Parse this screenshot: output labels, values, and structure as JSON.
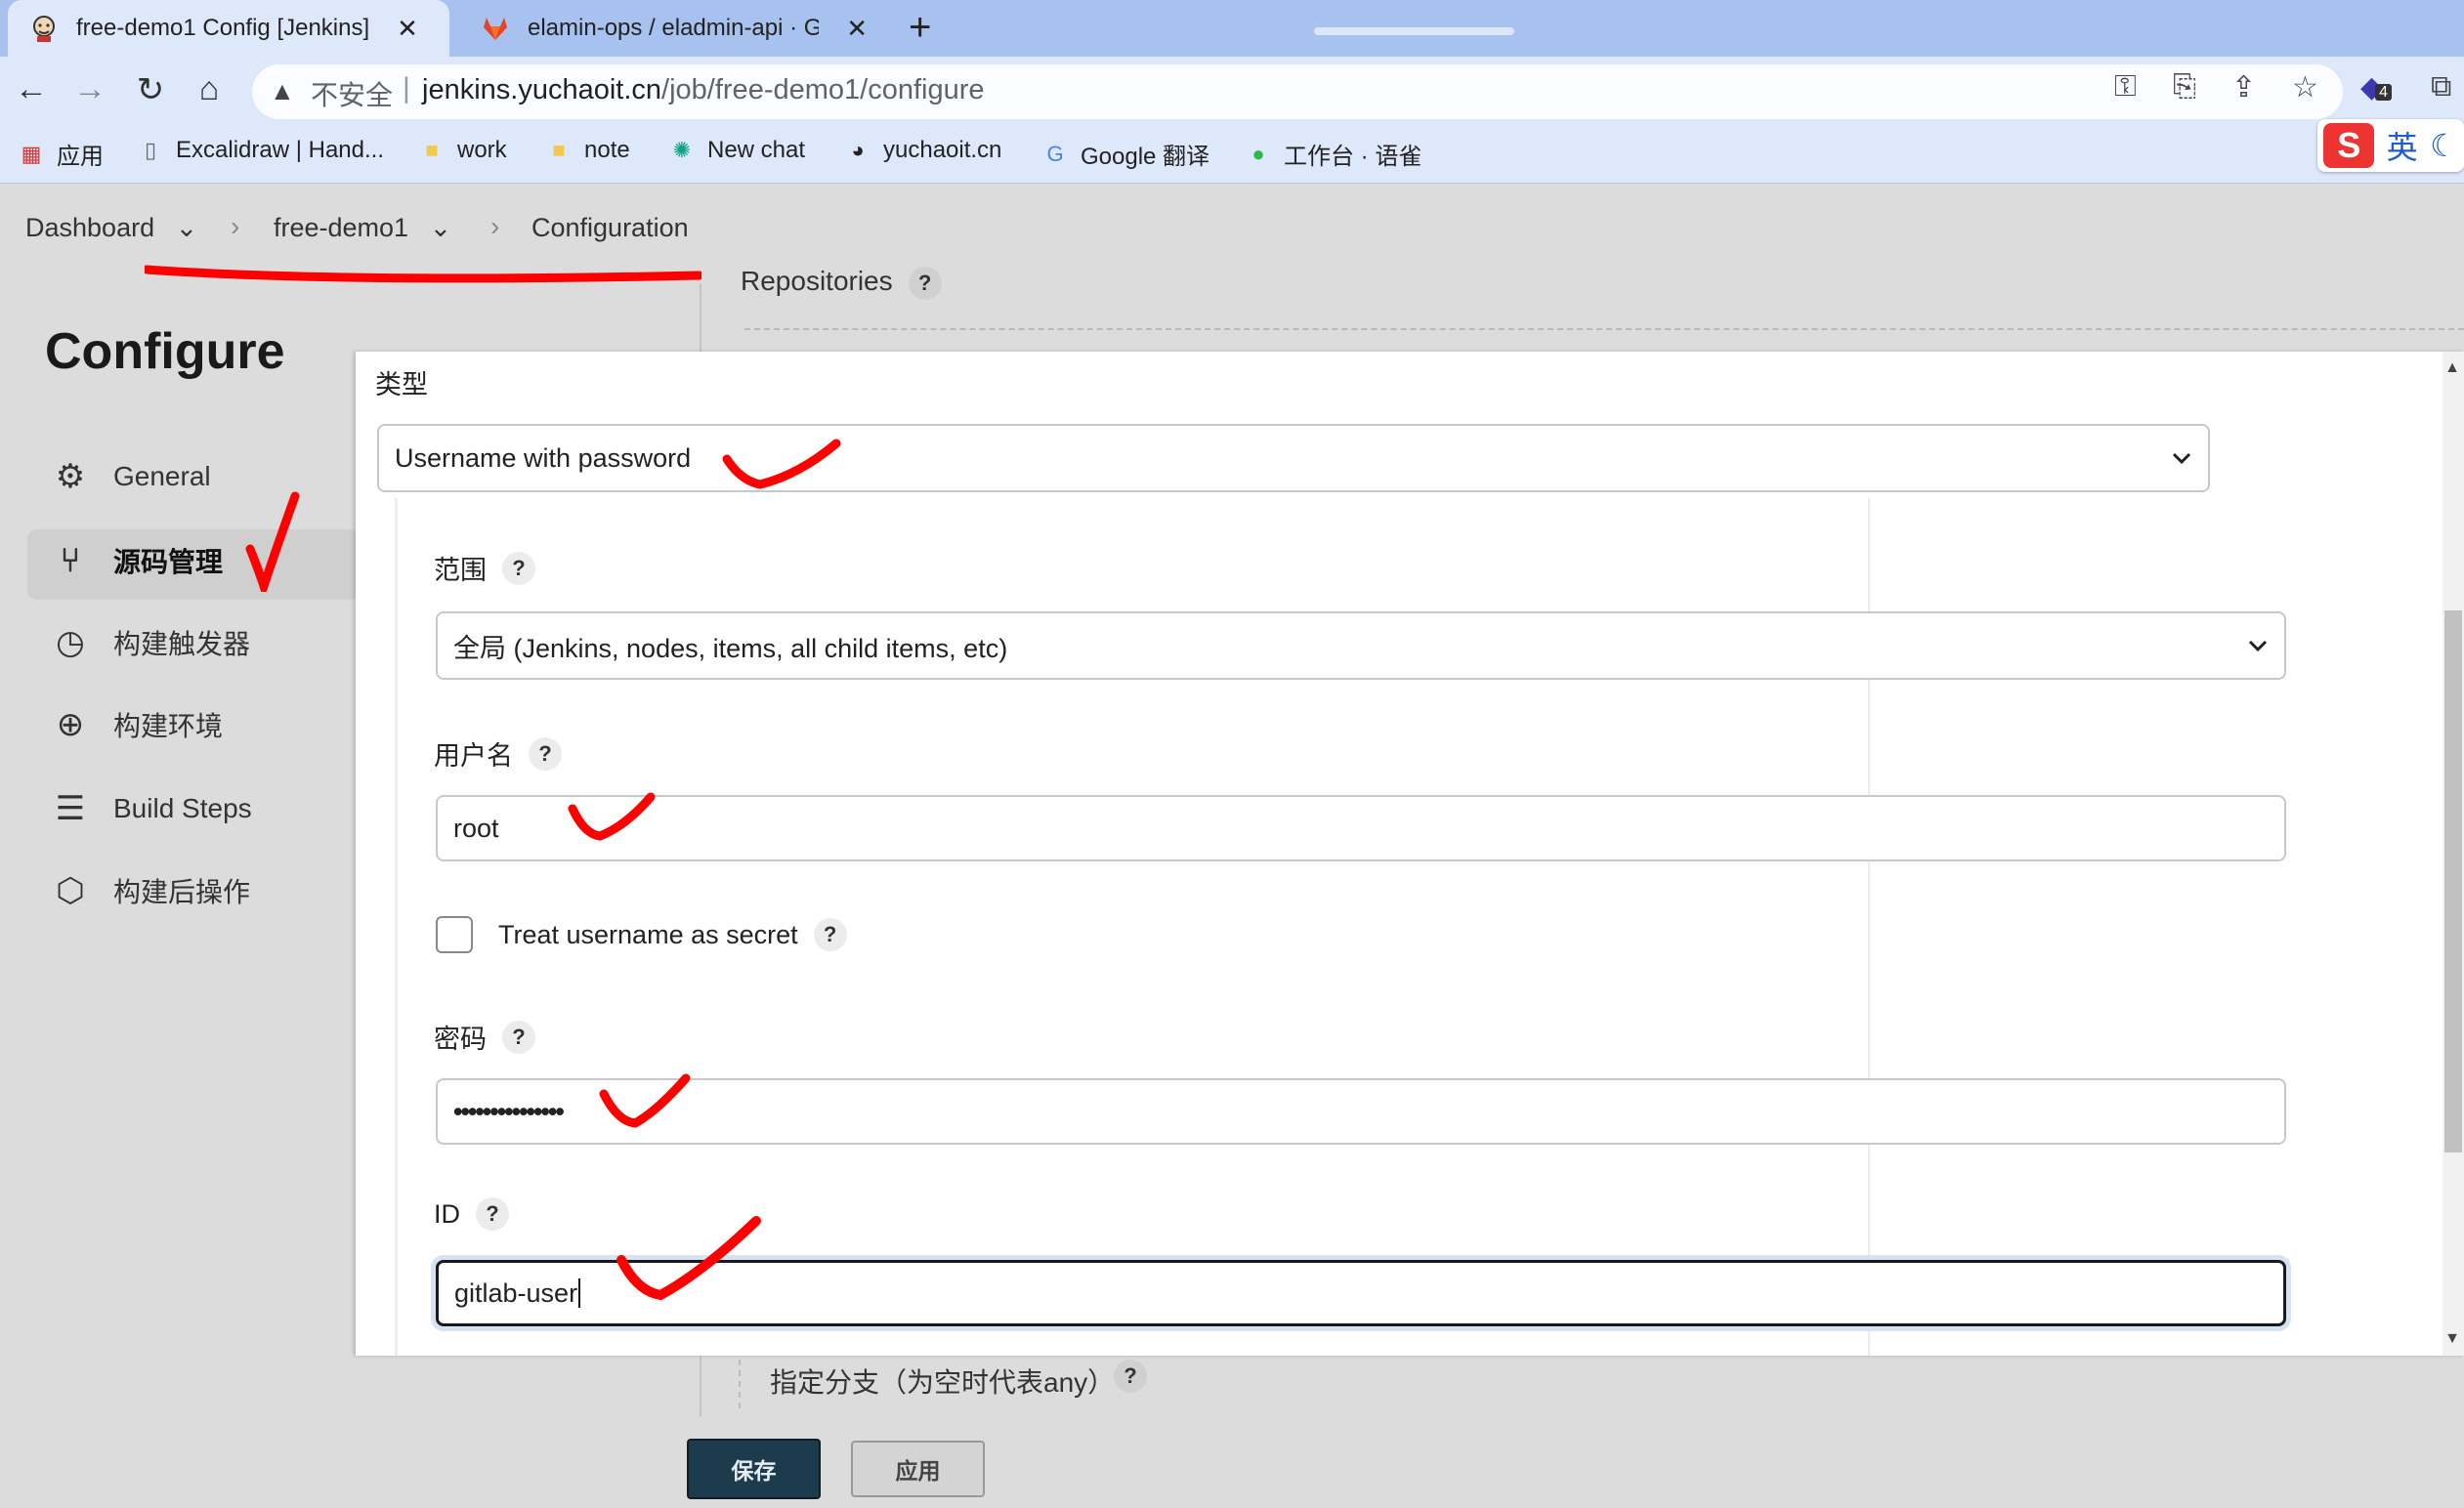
{
  "browser": {
    "tabs": [
      {
        "title": "free-demo1 Config [Jenkins]",
        "icon": "jenkins-icon",
        "active": true
      },
      {
        "title": "elamin-ops / eladmin-api · Git",
        "icon": "gitlab-icon",
        "active": false
      }
    ],
    "address": {
      "security_label": "不安全",
      "host": "jenkins.yuchaoit.cn",
      "path": "/job/free-demo1/configure"
    },
    "extension_badge": "4",
    "ime": {
      "logo": "S",
      "lang": "英"
    },
    "bookmarks": [
      {
        "label": "应用",
        "icon": "apps-grid-icon"
      },
      {
        "label": "Excalidraw | Hand...",
        "icon": "excalidraw-icon"
      },
      {
        "label": "work",
        "icon": "folder-icon"
      },
      {
        "label": "note",
        "icon": "folder-icon"
      },
      {
        "label": "New chat",
        "icon": "openai-icon"
      },
      {
        "label": "yuchaoit.cn",
        "icon": "globe-icon"
      },
      {
        "label": "Google 翻译",
        "icon": "google-translate-icon"
      },
      {
        "label": "工作台 · 语雀",
        "icon": "yuque-icon"
      }
    ]
  },
  "breadcrumb": {
    "items": [
      "Dashboard",
      "free-demo1",
      "Configuration"
    ]
  },
  "sidebar": {
    "title": "Configure",
    "items": [
      {
        "label": "General",
        "icon": "gear-icon"
      },
      {
        "label": "源码管理",
        "icon": "branch-icon",
        "active": true
      },
      {
        "label": "构建触发器",
        "icon": "clock-icon"
      },
      {
        "label": "构建环境",
        "icon": "globe-icon"
      },
      {
        "label": "Build Steps",
        "icon": "list-icon"
      },
      {
        "label": "构建后操作",
        "icon": "package-icon"
      }
    ]
  },
  "main": {
    "repositories_label": "Repositories",
    "branch_label": "指定分支（为空时代表any）",
    "save_label": "保存",
    "apply_label": "应用"
  },
  "dialog": {
    "kind_label": "类型",
    "kind_value": "Username with password",
    "scope_label": "范围",
    "scope_value": "全局 (Jenkins, nodes, items, all child items, etc)",
    "username_label": "用户名",
    "username_value": "root",
    "treat_secret_label": "Treat username as secret",
    "treat_secret_checked": false,
    "password_label": "密码",
    "password_value": "•••••••••••••••",
    "id_label": "ID",
    "id_value": "gitlab-user",
    "help_glyph": "?"
  },
  "annotation_color": "#ff0000"
}
